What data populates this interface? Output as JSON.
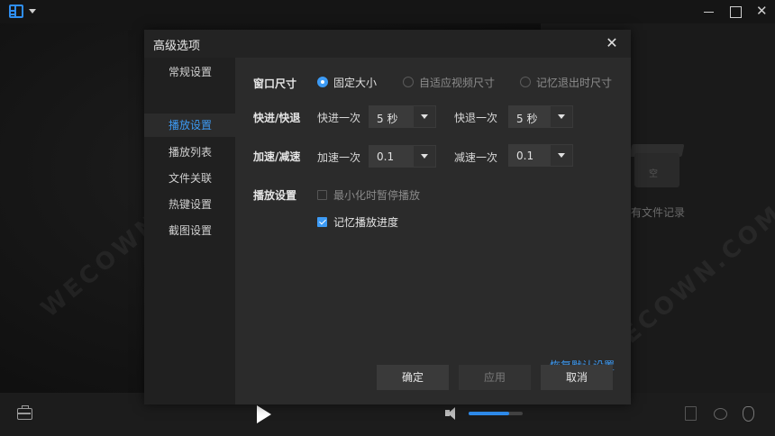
{
  "dialog": {
    "title": "高级选项",
    "close_glyph": "✕"
  },
  "sidebar": {
    "items": [
      {
        "label": "常规设置",
        "active": false
      },
      {
        "label": "播放设置",
        "active": true
      },
      {
        "label": "播放列表",
        "active": false
      },
      {
        "label": "文件关联",
        "active": false
      },
      {
        "label": "热键设置",
        "active": false
      },
      {
        "label": "截图设置",
        "active": false
      }
    ]
  },
  "window_size": {
    "label": "窗口尺寸",
    "options": [
      {
        "label": "固定大小",
        "selected": true
      },
      {
        "label": "自适应视频尺寸",
        "selected": false
      },
      {
        "label": "记忆退出时尺寸",
        "selected": false
      }
    ]
  },
  "seek": {
    "label": "快进/快退",
    "forward_label": "快进一次",
    "forward_value": "5 秒",
    "backward_label": "快退一次",
    "backward_value": "5 秒"
  },
  "speed": {
    "label": "加速/减速",
    "up_label": "加速一次",
    "up_value": "0.1",
    "down_label": "减速一次",
    "down_value": "0.1"
  },
  "playback": {
    "label": "播放设置",
    "pause_on_minimize": {
      "label": "最小化时暂停播放",
      "checked": false
    },
    "remember_progress": {
      "label": "记忆播放进度",
      "checked": true
    }
  },
  "restore_defaults": "恢复默认设置",
  "buttons": {
    "ok": "确定",
    "apply": "应用",
    "cancel": "取消"
  },
  "player": {
    "empty_text": "有文件记录",
    "empty_box_tag": "空",
    "volume_level": 0.75,
    "watermark": "WECOWN.COM"
  },
  "colors": {
    "accent": "#3d9bf5",
    "dialog_bg": "#2b2b2b",
    "sidebar_bg": "#202020"
  }
}
